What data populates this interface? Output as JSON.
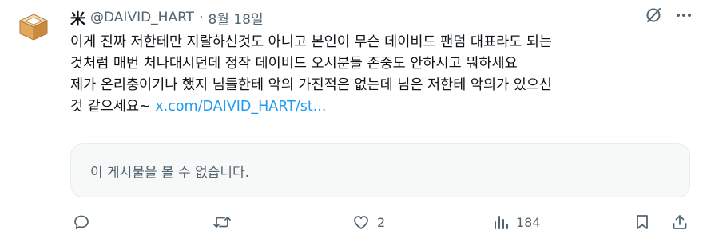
{
  "author": {
    "display_name": "米",
    "handle": "@DAIVID_HART",
    "separator": "·",
    "date": "8월 18일"
  },
  "post": {
    "lines": [
      "이게 진짜 저한테만 지랄하신것도 아니고 본인이 무슨 데이비드 팬덤 대표라도 되는",
      "것처럼 매번 처나대시던데 정작 데이비드 오시분들 존중도 안하시고 뭐하세요",
      "제가 온리충이기나 했지 님들한테 악의 가진적은 없는데 님은 저한테 악의가 있으신"
    ],
    "last_line_text": "것 같으세요~ ",
    "link_text": "x.com/DAIVID_HART/st..."
  },
  "quoted": {
    "unavailable_text": "이 게시물을 볼 수 없습니다."
  },
  "stats": {
    "likes": "2",
    "views": "184"
  },
  "icons": {
    "avatar": "wooden-masu-box-icon",
    "grok": "slashed-circle-icon",
    "more": "more-dots-icon",
    "reply": "reply-icon",
    "repost": "repost-icon",
    "like": "heart-icon",
    "views": "views-bar-icon",
    "bookmark": "bookmark-icon",
    "share": "share-icon"
  },
  "colors": {
    "text": "#0f1419",
    "secondary": "#536471",
    "link": "#1d9bf0",
    "card_bg": "#f7f9f9"
  }
}
